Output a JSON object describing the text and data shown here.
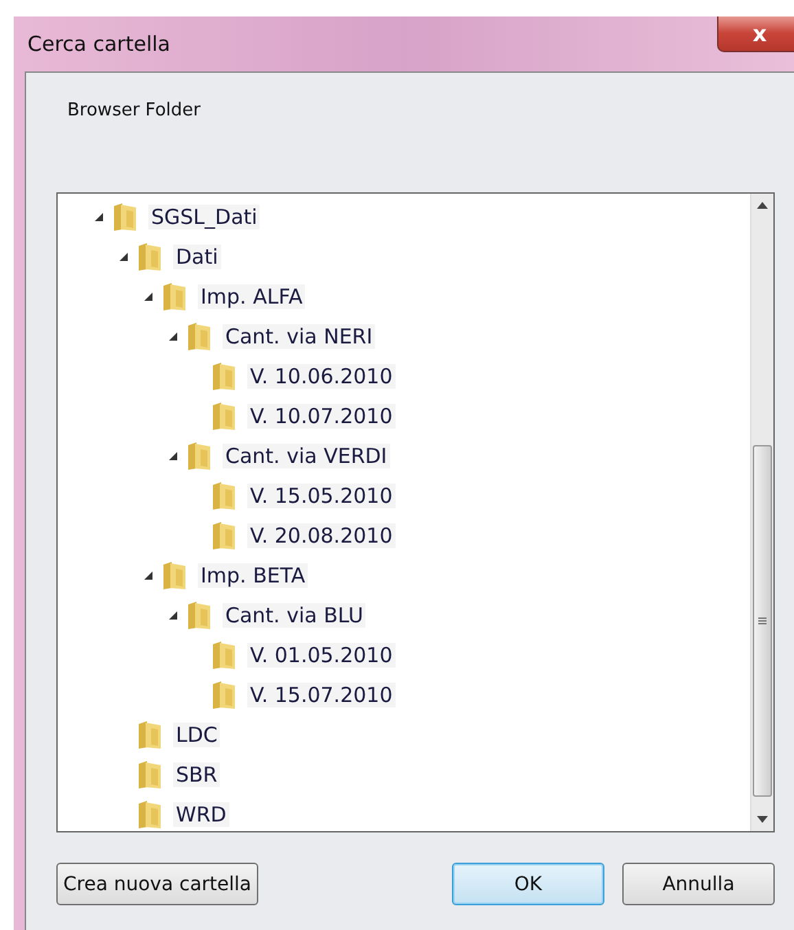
{
  "window": {
    "title": "Cerca cartella",
    "close": "x"
  },
  "description": "Browser Folder",
  "tree": [
    {
      "label": "SGSL_Dati",
      "expanded": true,
      "children": [
        {
          "label": "Dati",
          "expanded": true,
          "children": [
            {
              "label": "Imp. ALFA",
              "expanded": true,
              "children": [
                {
                  "label": "Cant. via NERI",
                  "expanded": true,
                  "children": [
                    {
                      "label": "V. 10.06.2010"
                    },
                    {
                      "label": "V. 10.07.2010"
                    }
                  ]
                },
                {
                  "label": "Cant. via VERDI",
                  "expanded": true,
                  "children": [
                    {
                      "label": "V. 15.05.2010"
                    },
                    {
                      "label": "V. 20.08.2010"
                    }
                  ]
                }
              ]
            },
            {
              "label": "Imp. BETA",
              "expanded": true,
              "children": [
                {
                  "label": "Cant. via BLU",
                  "expanded": true,
                  "children": [
                    {
                      "label": "V. 01.05.2010"
                    },
                    {
                      "label": "V. 15.07.2010"
                    }
                  ]
                }
              ]
            }
          ]
        },
        {
          "label": "LDC"
        },
        {
          "label": "SBR"
        },
        {
          "label": "WRD"
        }
      ]
    }
  ],
  "buttons": [
    {
      "label": "Crea nuova cartella",
      "kind": "secondary"
    },
    {
      "label": "OK",
      "kind": "default"
    },
    {
      "label": "Annulla",
      "kind": "secondary"
    }
  ]
}
